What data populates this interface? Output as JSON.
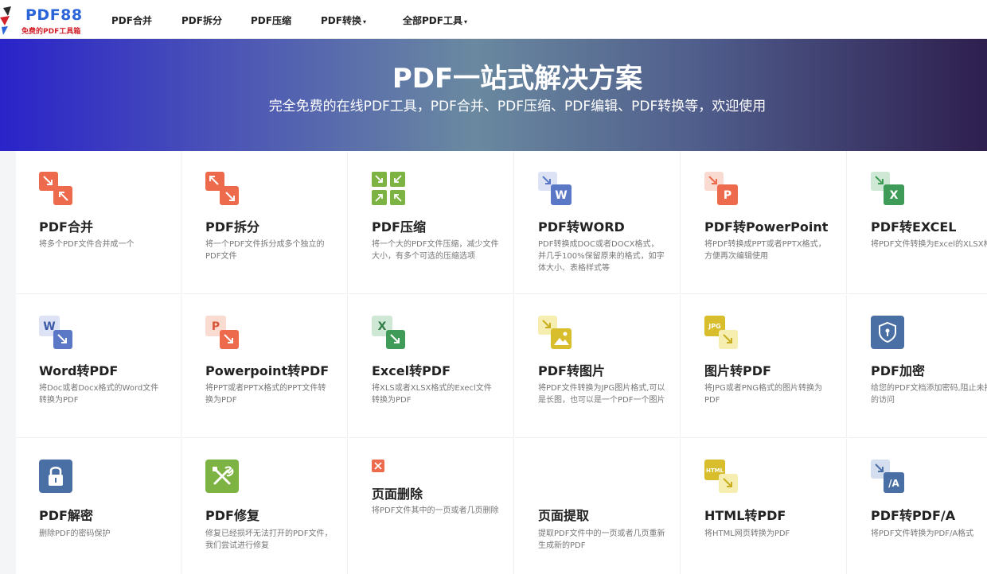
{
  "header": {
    "logo_title": "PDF88",
    "logo_subtitle": "免费的PDF工具箱",
    "nav": [
      {
        "label": "PDF合并",
        "dropdown": false
      },
      {
        "label": "PDF拆分",
        "dropdown": false
      },
      {
        "label": "PDF压缩",
        "dropdown": false
      },
      {
        "label": "PDF转换",
        "dropdown": true
      },
      {
        "label": "全部PDF工具",
        "dropdown": true
      }
    ],
    "caret_glyph": "▾"
  },
  "banner": {
    "title": "PDF一站式解决方案",
    "subtitle": "完全免费的在线PDF工具，PDF合并、PDF压缩、PDF编辑、PDF转换等，欢迎使用"
  },
  "tools": [
    {
      "title": "PDF合并",
      "desc": "将多个PDF文件合并成一个",
      "icon": "merge-icon"
    },
    {
      "title": "PDF拆分",
      "desc": "将一个PDF文件拆分成多个独立的PDF文件",
      "icon": "split-icon"
    },
    {
      "title": "PDF压缩",
      "desc": "将一个大的PDF文件压缩，减少文件大小，有多个可选的压缩选项",
      "icon": "compress-icon"
    },
    {
      "title": "PDF转WORD",
      "desc": "PDF转换成DOC或者DOCX格式，并几乎100%保留原来的格式，如字体大小、表格样式等",
      "icon": "pdf-to-word-icon",
      "badge": "W"
    },
    {
      "title": "PDF转PowerPoint",
      "desc": "将PDF转换成PPT或者PPTX格式，方便再次编辑使用",
      "icon": "pdf-to-ppt-icon",
      "badge": "P"
    },
    {
      "title": "PDF转EXCEL",
      "desc": "将PDF文件转换为Excel的XLSX格式",
      "icon": "pdf-to-excel-icon",
      "badge": "X"
    },
    {
      "title": "Word转PDF",
      "desc": "将Doc或者Docx格式的Word文件转换为PDF",
      "icon": "word-to-pdf-icon",
      "badge": "W"
    },
    {
      "title": "Powerpoint转PDF",
      "desc": "将PPT或者PPTX格式的PPT文件转换为PDF",
      "icon": "ppt-to-pdf-icon",
      "badge": "P"
    },
    {
      "title": "Excel转PDF",
      "desc": "将XLS或者XLSX格式的Execl文件转换为PDF",
      "icon": "excel-to-pdf-icon",
      "badge": "X"
    },
    {
      "title": "PDF转图片",
      "desc": "将PDF文件转换为JPG图片格式,可以是长图，也可以是一个PDF一个图片",
      "icon": "pdf-to-image-icon"
    },
    {
      "title": "图片转PDF",
      "desc": "将JPG或者PNG格式的图片转换为PDF",
      "icon": "image-to-pdf-icon",
      "badge": "JPG"
    },
    {
      "title": "PDF加密",
      "desc": "给您的PDF文档添加密码,阻止未授权的访问",
      "icon": "shield-icon"
    },
    {
      "title": "PDF解密",
      "desc": "删除PDF的密码保护",
      "icon": "lock-icon"
    },
    {
      "title": "PDF修复",
      "desc": "修复已经损坏无法打开的PDF文件，我们尝试进行修复",
      "icon": "repair-tools-icon"
    },
    {
      "title": "页面删除",
      "desc": "将PDF文件其中的一页或者几页删除",
      "icon": "delete-page-icon"
    },
    {
      "title": "页面提取",
      "desc": "提取PDF文件中的一页或者几页重新生成新的PDF",
      "icon": "extract-page-icon"
    },
    {
      "title": "HTML转PDF",
      "desc": "将HTML网页转换为PDF",
      "icon": "html-to-pdf-icon",
      "badge": "HTML"
    },
    {
      "title": "PDF转PDF/A",
      "desc": "将PDF文件转换为PDF/A格式",
      "icon": "pdf-to-pdfa-icon",
      "badge": "/A"
    }
  ],
  "colors": {
    "brand_blue": "#2b63d9",
    "brand_red": "#d2212a",
    "orange": "#ee6a4c",
    "green": "#7cb342",
    "word_blue": "#5b78c7",
    "excel_green": "#3f9b58",
    "yellow": "#e0c63a",
    "slate_blue": "#4a6fa5"
  }
}
